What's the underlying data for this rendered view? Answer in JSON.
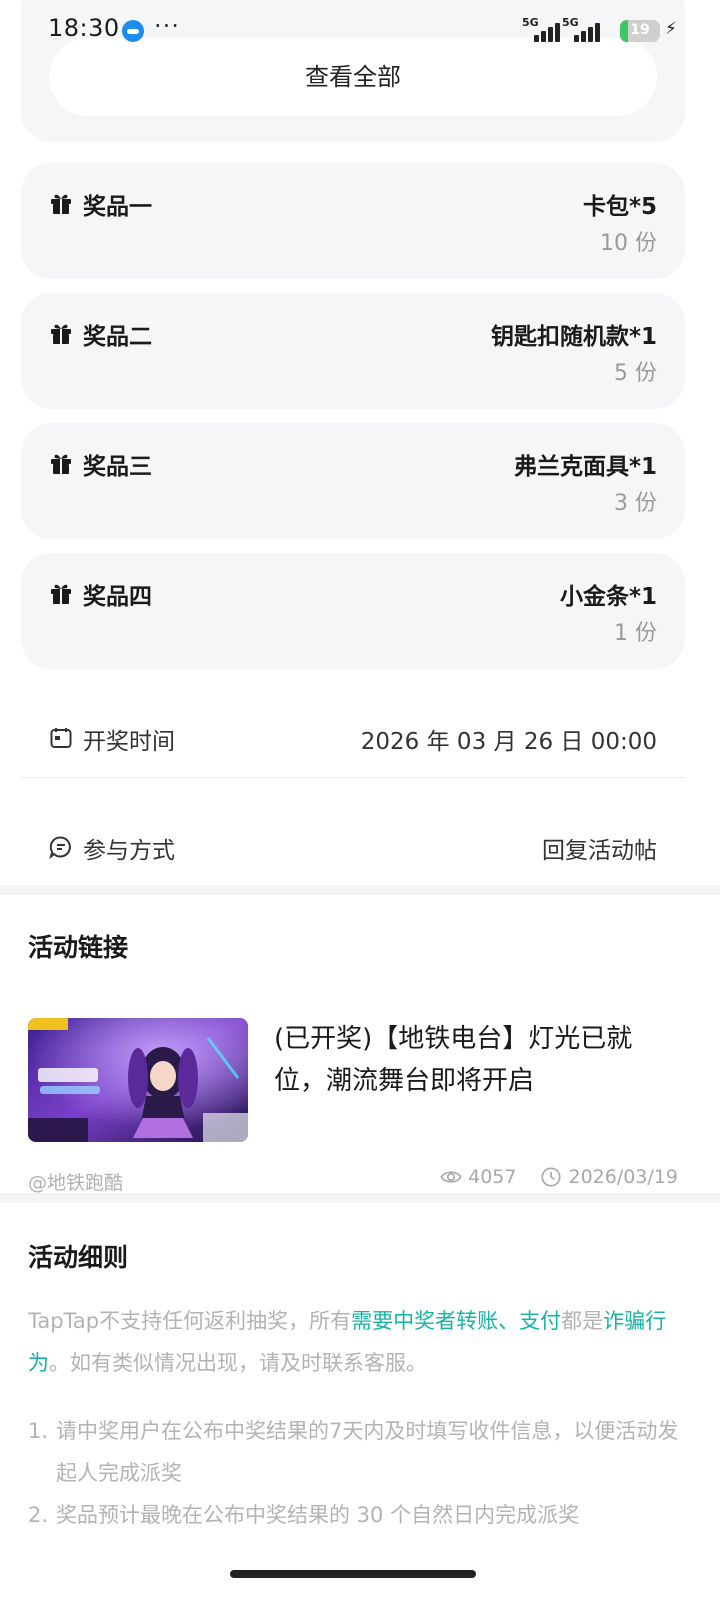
{
  "status_bar": {
    "time": "18:30",
    "more": "···",
    "signal_tags": [
      "5G",
      "5G"
    ],
    "battery_level": "19",
    "battery_fraction": 0.19
  },
  "top_card": {
    "view_all_label": "查看全部"
  },
  "prizes": [
    {
      "name": "奖品一",
      "item": "卡包*5",
      "quantity": "10 份"
    },
    {
      "name": "奖品二",
      "item": "钥匙扣随机款*1",
      "quantity": "5 份"
    },
    {
      "name": "奖品三",
      "item": "弗兰克面具*1",
      "quantity": "3 份"
    },
    {
      "name": "奖品四",
      "item": "小金条*1",
      "quantity": "1 份"
    }
  ],
  "draw_time": {
    "label": "开奖时间",
    "value": "2026 年 03 月 26 日 00:00"
  },
  "participation": {
    "label": "参与方式",
    "value": "回复活动帖"
  },
  "activity_link": {
    "section_title": "活动链接",
    "post_title": "(已开奖)【地铁电台】灯光已就位，潮流舞台即将开启",
    "author": "@地铁跑酷",
    "views": "4057",
    "date": "2026/03/19"
  },
  "activity_rules": {
    "section_title": "活动细则",
    "intro_part1": "TapTap不支持任何返利抽奖，所有",
    "intro_highlight1": "需要中奖者转账、支付",
    "intro_part2": "都是",
    "intro_highlight2": "诈骗行为",
    "intro_part3": "。如有类似情况出现，请及时联系客服。",
    "items": [
      {
        "num": "1.",
        "text": "请中奖用户在公布中奖结果的7天内及时填写收件信息，以便活动发起人完成派奖"
      },
      {
        "num": "2.",
        "text": "奖品预计最晚在公布中奖结果的 30 个自然日内完成派奖"
      }
    ]
  },
  "colors": {
    "accent": "#15b5a6",
    "card_bg": "#f5f6f8",
    "muted_text": "#b3b3b3"
  }
}
